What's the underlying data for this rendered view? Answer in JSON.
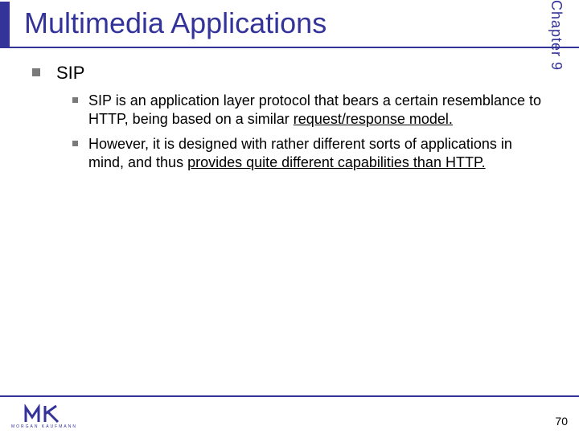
{
  "header": {
    "title": "Multimedia Applications",
    "chapter": "Chapter 9"
  },
  "content": {
    "heading": "SIP",
    "bullets": [
      {
        "pre": "SIP is an application layer protocol that bears a certain resemblance to HTTP, being based on a similar ",
        "underlined": "request/response model.",
        "post": ""
      },
      {
        "pre": "However, it is designed with rather different sorts of applications in mind, and thus ",
        "underlined": "provides quite different capabilities than HTTP.",
        "post": ""
      }
    ]
  },
  "footer": {
    "publisher": "MORGAN KAUFMANN",
    "page": "70"
  }
}
